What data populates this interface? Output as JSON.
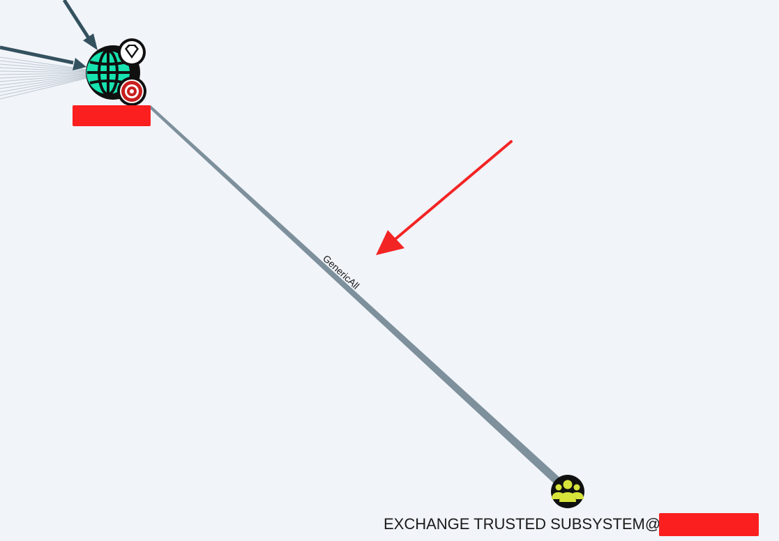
{
  "graph": {
    "edge": {
      "label": "GenericAll",
      "color": "#7d909c"
    },
    "domain_node": {
      "icon": "globe-icon",
      "badges": [
        "diamond-icon",
        "target-icon"
      ],
      "color": "#17e3b0",
      "label_redacted": true
    },
    "group_node": {
      "icon": "users-icon",
      "color": "#d7e33b",
      "label": "EXCHANGE TRUSTED SUBSYSTEM@",
      "label_redacted_suffix": true
    },
    "incoming_edges_color": "#34515f",
    "annotation": {
      "type": "arrow",
      "color": "#f32424"
    },
    "redaction_color": "#fb1f1f"
  }
}
